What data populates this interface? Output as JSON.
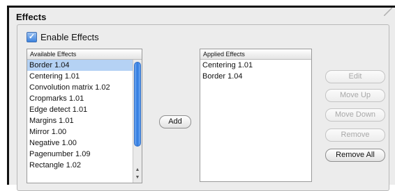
{
  "panel": {
    "title": "Effects",
    "enable_checkbox": {
      "label": "Enable Effects",
      "checked": true
    }
  },
  "available_list": {
    "header": "Available Effects",
    "selected_index": 0,
    "items": [
      "Border 1.04",
      "Centering 1.01",
      "Convolution matrix 1.02",
      "Cropmarks 1.01",
      "Edge detect 1.01",
      "Margins 1.01",
      "Mirror 1.00",
      "Negative 1.00",
      "Pagenumber 1.09",
      "Rectangle 1.02"
    ]
  },
  "applied_list": {
    "header": "Applied Effects",
    "items": [
      "Centering 1.01",
      "Border 1.04"
    ]
  },
  "buttons": {
    "add": "Add",
    "edit": "Edit",
    "move_up": "Move Up",
    "move_down": "Move Down",
    "remove": "Remove",
    "remove_all": "Remove All"
  },
  "colors": {
    "selection": "#b5d2f4",
    "checkbox_accent": "#3c83de",
    "scroll_thumb": "#2f7ae0"
  }
}
